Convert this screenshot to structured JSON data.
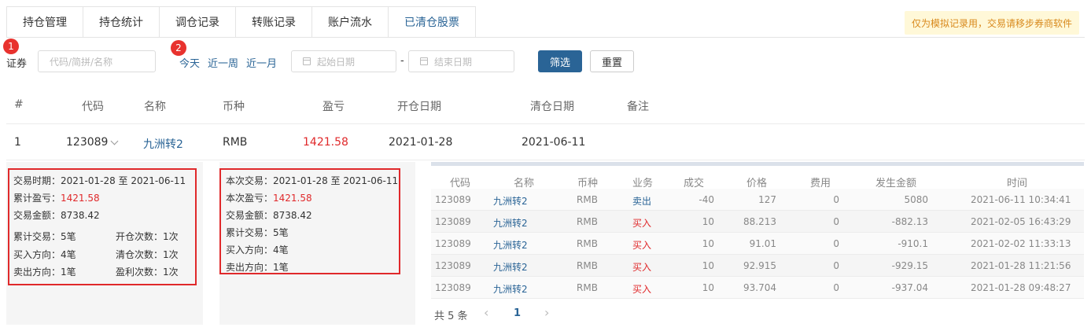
{
  "tabs": [
    {
      "label": "持仓管理"
    },
    {
      "label": "持仓统计"
    },
    {
      "label": "调仓记录"
    },
    {
      "label": "转账记录"
    },
    {
      "label": "账户流水"
    },
    {
      "label": "已清仓股票"
    }
  ],
  "notice": "仅为模拟记录用，交易请移步券商软件",
  "badges": [
    "1",
    "2"
  ],
  "filter": {
    "security_label": "证券",
    "security_placeholder": "代码/简拼/名称",
    "quick": [
      "今天",
      "近一周",
      "近一月"
    ],
    "start_placeholder": "起始日期",
    "dash": "-",
    "end_placeholder": "结束日期",
    "filter_btn": "筛选",
    "reset_btn": "重置"
  },
  "table": {
    "headers": [
      "#",
      "代码",
      "名称",
      "币种",
      "盈亏",
      "开仓日期",
      "清仓日期",
      "备注"
    ],
    "row": {
      "idx": "1",
      "code": "123089",
      "name": "九洲转2",
      "currency": "RMB",
      "pnl": "1421.58",
      "open": "2021-01-28",
      "close": "2021-06-11"
    }
  },
  "summary_left": {
    "period": "交易时期：2021-01-28 至 2021-06-11",
    "pnl_label": "累计盈亏：",
    "pnl": "1421.58",
    "amount": "交易金额：8738.42",
    "trades": "累计交易：5笔",
    "open_count": "开仓次数：1次",
    "buys": "买入方向：4笔",
    "clear_count": "清仓次数：1次",
    "sells": "卖出方向：1笔",
    "win_count": "盈利次数：1次"
  },
  "summary_right": {
    "period": "本次交易：2021-01-28 至 2021-06-11",
    "pnl_label": "本次盈亏：",
    "pnl": "1421.58",
    "amount": "交易金额：8738.42",
    "trades": "累计交易：5笔",
    "buys": "买入方向：4笔",
    "sells": "卖出方向：1笔"
  },
  "sub": {
    "headers": [
      "代码",
      "名称",
      "币种",
      "业务",
      "成交",
      "价格",
      "费用",
      "发生金额",
      "时间"
    ],
    "rows": [
      {
        "code": "123089",
        "name": "九洲转2",
        "cur": "RMB",
        "biz": "卖出",
        "qty": "-40",
        "price": "127",
        "fee": "0",
        "amt": "5080",
        "time": "2021-06-11 10:34:41"
      },
      {
        "code": "123089",
        "name": "九洲转2",
        "cur": "RMB",
        "biz": "买入",
        "qty": "10",
        "price": "88.213",
        "fee": "0",
        "amt": "-882.13",
        "time": "2021-02-05 16:43:29"
      },
      {
        "code": "123089",
        "name": "九洲转2",
        "cur": "RMB",
        "biz": "买入",
        "qty": "10",
        "price": "91.01",
        "fee": "0",
        "amt": "-910.1",
        "time": "2021-02-02 11:33:13"
      },
      {
        "code": "123089",
        "name": "九洲转2",
        "cur": "RMB",
        "biz": "买入",
        "qty": "10",
        "price": "92.915",
        "fee": "0",
        "amt": "-929.15",
        "time": "2021-01-28 11:21:56"
      },
      {
        "code": "123089",
        "name": "九洲转2",
        "cur": "RMB",
        "biz": "买入",
        "qty": "10",
        "price": "93.704",
        "fee": "0",
        "amt": "-937.04",
        "time": "2021-01-28 09:48:27"
      }
    ],
    "total": "共 5 条",
    "page": "1",
    "prev": "‹",
    "next": "›"
  },
  "colors": {
    "accent": "#2a6496",
    "red": "#e0292b"
  }
}
